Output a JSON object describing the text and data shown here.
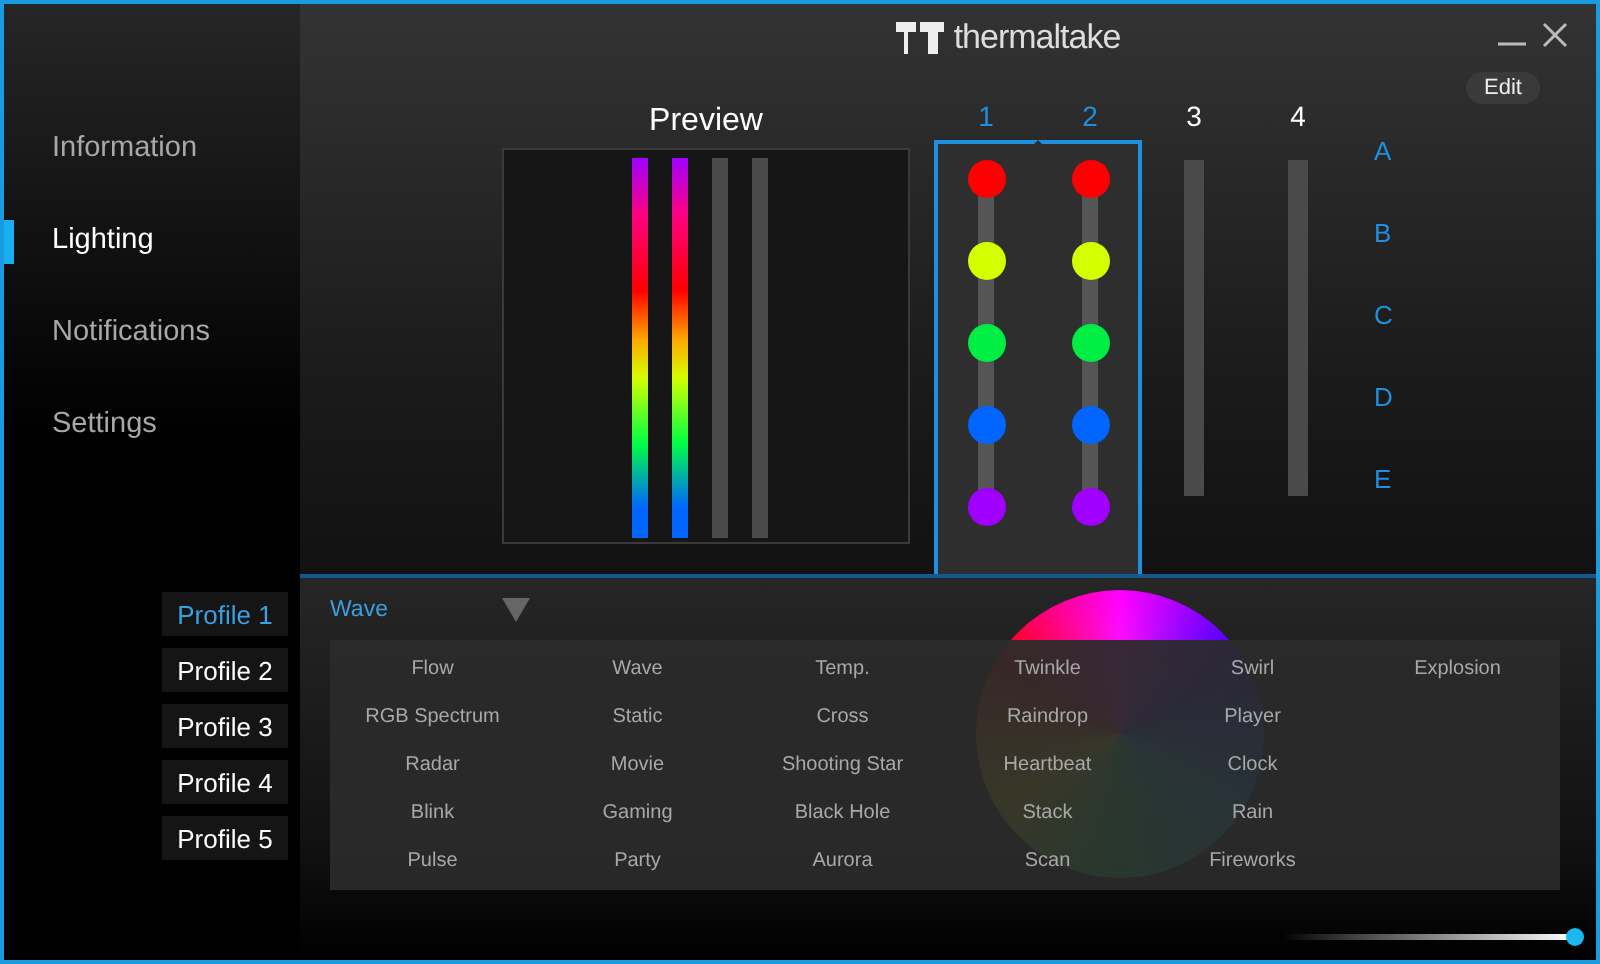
{
  "window": {
    "logo_text": "thermaltake",
    "edit_button": "Edit"
  },
  "nav": [
    {
      "label": "Information",
      "selected": false
    },
    {
      "label": "Lighting",
      "selected": true
    },
    {
      "label": "Notifications",
      "selected": false
    },
    {
      "label": "Settings",
      "selected": false
    }
  ],
  "profiles": [
    {
      "label": "Profile 1",
      "selected": true
    },
    {
      "label": "Profile 2",
      "selected": false
    },
    {
      "label": "Profile 3",
      "selected": false
    },
    {
      "label": "Profile 4",
      "selected": false
    },
    {
      "label": "Profile 5",
      "selected": false
    }
  ],
  "preview": {
    "title": "Preview",
    "strips": [
      {
        "lit": true
      },
      {
        "lit": true
      },
      {
        "lit": false
      },
      {
        "lit": false
      }
    ]
  },
  "zones": {
    "columns": [
      {
        "label": "1",
        "selected": true,
        "leds": [
          {
            "color": "#ff0000"
          },
          {
            "color": "#d4ff00"
          },
          {
            "color": "#00ee44"
          },
          {
            "color": "#0066ff"
          },
          {
            "color": "#a000ff"
          }
        ]
      },
      {
        "label": "2",
        "selected": true,
        "leds": [
          {
            "color": "#ff0000"
          },
          {
            "color": "#d4ff00"
          },
          {
            "color": "#00ee44"
          },
          {
            "color": "#0066ff"
          },
          {
            "color": "#a000ff"
          }
        ]
      },
      {
        "label": "3",
        "selected": false
      },
      {
        "label": "4",
        "selected": false
      }
    ],
    "rows": [
      "A",
      "B",
      "C",
      "D",
      "E"
    ]
  },
  "effect": {
    "value": "Wave",
    "expanded": true,
    "options": [
      "Flow",
      "RGB Spectrum",
      "Radar",
      "Blink",
      "Pulse",
      "Wave",
      "Static",
      "Movie",
      "Gaming",
      "Party",
      "Temp.",
      "Cross",
      "Shooting Star",
      "Black Hole",
      "Aurora",
      "Twinkle",
      "Raindrop",
      "Heartbeat",
      "Stack",
      "Scan",
      "Swirl",
      "Player",
      "Clock",
      "Rain",
      "Fireworks",
      "Explosion"
    ]
  },
  "brightness": {
    "level": 1
  }
}
